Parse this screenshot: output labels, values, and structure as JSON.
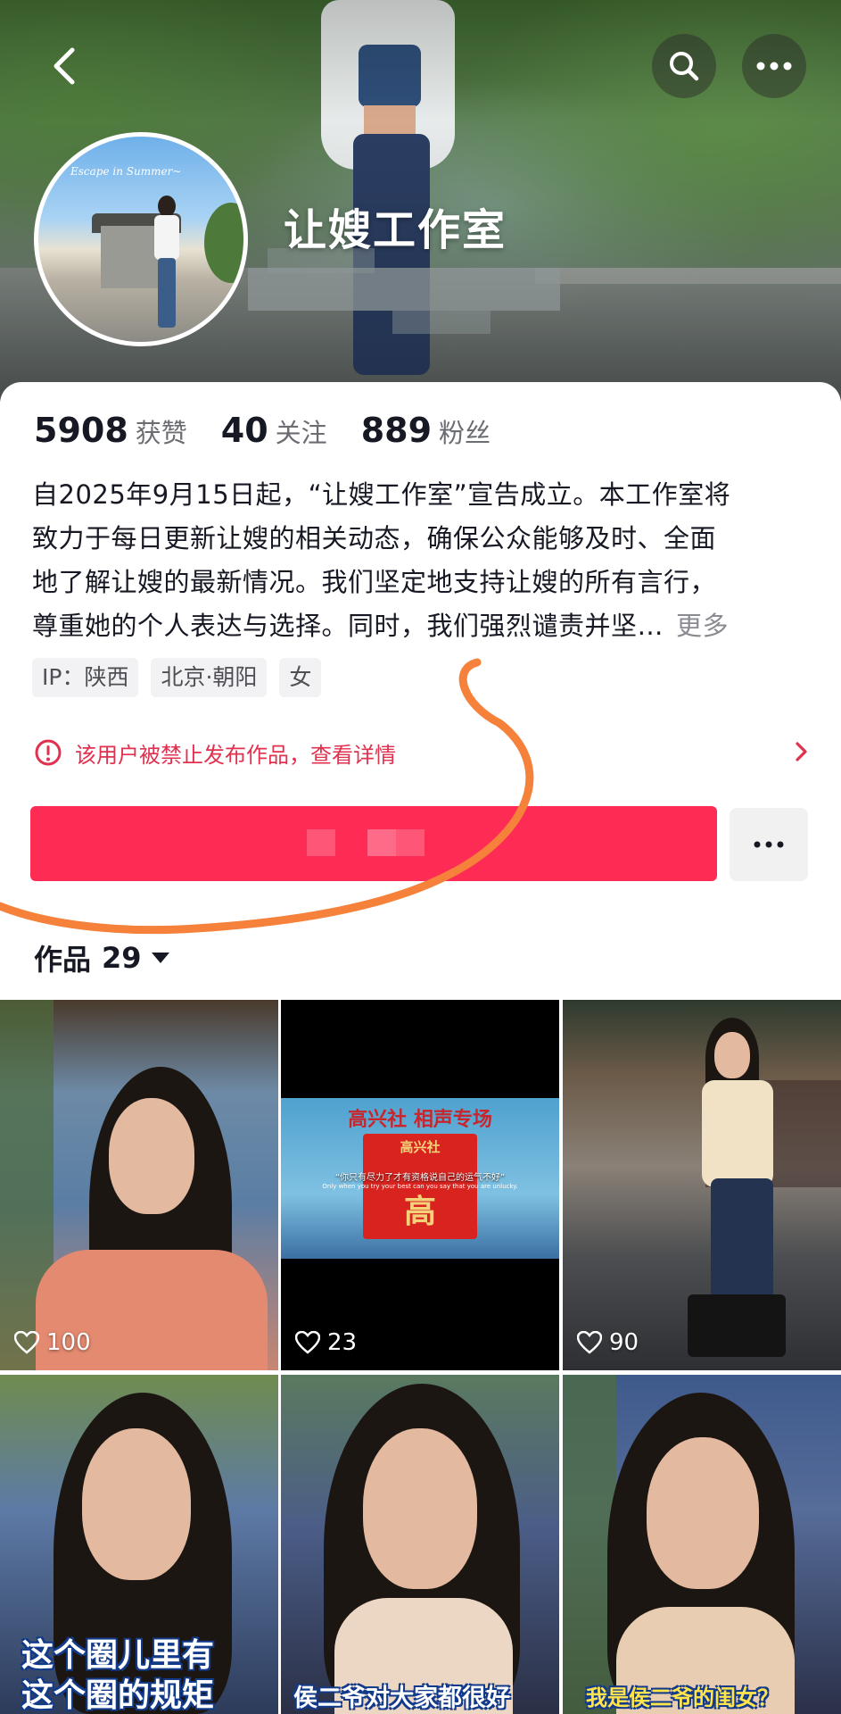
{
  "profile": {
    "display_name": "让嫂工作室",
    "avatar_overlay_text": "Escape in Summer~"
  },
  "stats": [
    {
      "value": "5908",
      "label": "获赞"
    },
    {
      "value": "40",
      "label": "关注"
    },
    {
      "value": "889",
      "label": "粉丝"
    }
  ],
  "bio": {
    "lines": [
      "自2025年9月15日起，“让嫂工作室”宣告成立。本工作室将",
      "致力于每日更新让嫂的相关动态，确保公众能够及时、全面",
      "地了解让嫂的最新情况。我们坚定地支持让嫂的所有言行，",
      "尊重她的个人表达与选择。同时，我们强烈谴责并坚…"
    ],
    "more_label": "更多"
  },
  "tags": [
    "IP：陕西",
    "北京·朝阳",
    "女"
  ],
  "notice": {
    "text": "该用户被禁止发布作品，查看详情",
    "color": "#e0314f"
  },
  "colors": {
    "accent": "#fe2c55",
    "annotation_stroke": "#f5813a"
  },
  "works": {
    "label": "作品",
    "count": "29"
  },
  "videos": [
    {
      "likes": "100"
    },
    {
      "likes": "23",
      "banner_title": "高兴社 相声专场",
      "banner_sub": "“你只有尽力了才有资格说自己的运气不好”",
      "banner_en": "Only when you try your best can you say that you are unlucky.",
      "curtain_text": "高兴社",
      "curtain_char": "高"
    },
    {
      "likes": "90"
    },
    {
      "caption_lines": [
        "这个圈儿里有",
        "这个圈的规矩"
      ]
    },
    {
      "caption_lines": [
        "侯二爷对大家都很好"
      ]
    },
    {
      "caption_lines": [
        "我是侯二爷的闺女？"
      ]
    }
  ],
  "icons": {
    "back": "chevron-left-icon",
    "search": "search-icon",
    "more": "more-horizontal-icon",
    "warning": "alert-circle-icon",
    "heart": "heart-icon"
  }
}
